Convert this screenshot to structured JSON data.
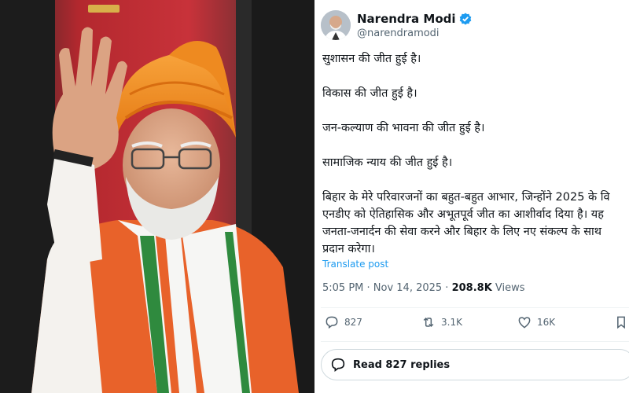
{
  "tweet": {
    "display_name": "Narendra Modi",
    "handle": "@narendramodi",
    "lines": [
      "सुशासन की जीत हुई है।",
      "",
      "विकास की जीत हुई है।",
      "",
      "जन-कल्याण की भावना की जीत हुई है।",
      "",
      "सामाजिक न्याय की जीत हुई है।",
      "",
      "बिहार के मेरे परिवारजनों का बहुत-बहुत आभार, जिन्होंने 2025 के वि",
      "एनडीए को ऐतिहासिक और अभूतपूर्व जीत का आशीर्वाद दिया है। यह",
      "जनता-जनार्दन की सेवा करने और बिहार के लिए नए संकल्प के साथ",
      "प्रदान करेगा।"
    ],
    "translate_label": "Translate post",
    "timestamp": "5:05 PM · Nov 14, 2025 · ",
    "views_count": "208.8K",
    "views_label": " Views",
    "replies": "827",
    "reposts": "3.1K",
    "likes": "16K",
    "read_replies_label": "Read 827 replies"
  },
  "colors": {
    "accent": "#1d9bf0",
    "turban": "#f28c1e",
    "jacket": "#e8622a"
  },
  "icons": [
    "verified-badge-icon",
    "reply-icon",
    "repost-icon",
    "like-icon",
    "bookmark-icon",
    "speech-bubble-icon"
  ]
}
